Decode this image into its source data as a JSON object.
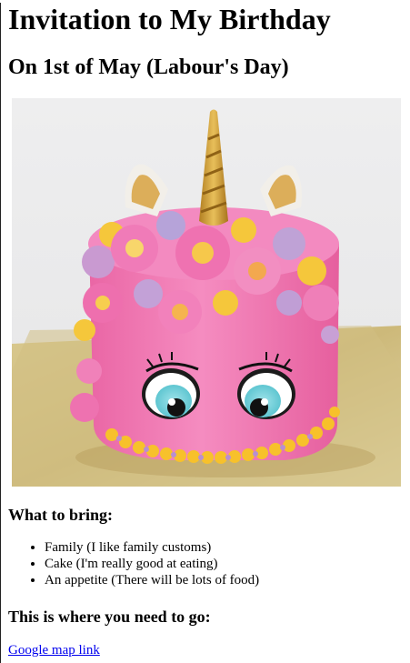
{
  "title": "Invitation to My Birthday",
  "subtitle": "On 1st of May (Labour's Day)",
  "bring_heading": "What to bring:",
  "bring_items": [
    "Family (I like family customs)",
    "Cake (I'm really good at eating)",
    "An appetite (There will be lots of food)"
  ],
  "location_heading": "This is where you need to go:",
  "map_link_label": "Google map link",
  "colors": {
    "link": "#0000ee",
    "cake_pink": "#f27fb8",
    "horn_gold": "#d7a33a"
  }
}
